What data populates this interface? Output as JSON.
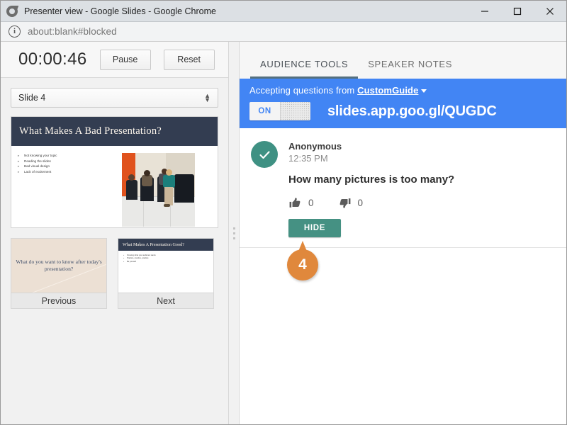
{
  "window": {
    "title": "Presenter view - Google Slides - Google Chrome",
    "app_icon": "chrome-logo-icon",
    "minimize_label": "Minimize",
    "maximize_label": "Maximize",
    "close_label": "Close"
  },
  "urlbar": {
    "info_icon": "info-circle-icon",
    "url": "about:blank#blocked"
  },
  "presenter": {
    "timer": "00:00:46",
    "pause_label": "Pause",
    "reset_label": "Reset",
    "slide_selector": {
      "value": "Slide 4",
      "spinner_up_icon": "chevron-up-icon",
      "spinner_down_icon": "chevron-down-icon"
    },
    "current_slide": {
      "title": "What Makes A Bad Presentation?",
      "bullets": [
        "Not knowing your topic",
        "Reading the slides",
        "Bad visual design",
        "Lack of excitement"
      ],
      "image_alt": "audience-photo"
    },
    "previous": {
      "label": "Previous",
      "text": "What do you want to know after today's presentation?"
    },
    "next": {
      "label": "Next",
      "title": "What Makes A Presentation Good?",
      "bullets": [
        "Knowing what your audience wants",
        "Practice, practice, practice",
        "Be yourself"
      ]
    },
    "splitter_icon": "drag-handle-icon"
  },
  "audience": {
    "tabs": [
      {
        "label": "AUDIENCE TOOLS",
        "active": true
      },
      {
        "label": "SPEAKER NOTES",
        "active": false
      }
    ],
    "banner": {
      "accepting_prefix": "Accepting questions from",
      "presenter_name": "CustomGuide",
      "dropdown_icon": "caret-down-icon",
      "toggle_on_label": "ON",
      "toggle_state": "ON",
      "short_url": "slides.app.goo.gl/QUGDC",
      "background_color": "#4285f4"
    },
    "questions": [
      {
        "avatar_icon": "check-circle-icon",
        "author": "Anonymous",
        "time": "12:35 PM",
        "text": "How many pictures is too many?",
        "thumbs_up_icon": "thumbs-up-icon",
        "thumbs_up_count": "0",
        "thumbs_down_icon": "thumbs-down-icon",
        "thumbs_down_count": "0",
        "hide_label": "HIDE",
        "hide_color": "#459183"
      }
    ],
    "callout": {
      "number": "4",
      "color": "#e0883c"
    }
  }
}
